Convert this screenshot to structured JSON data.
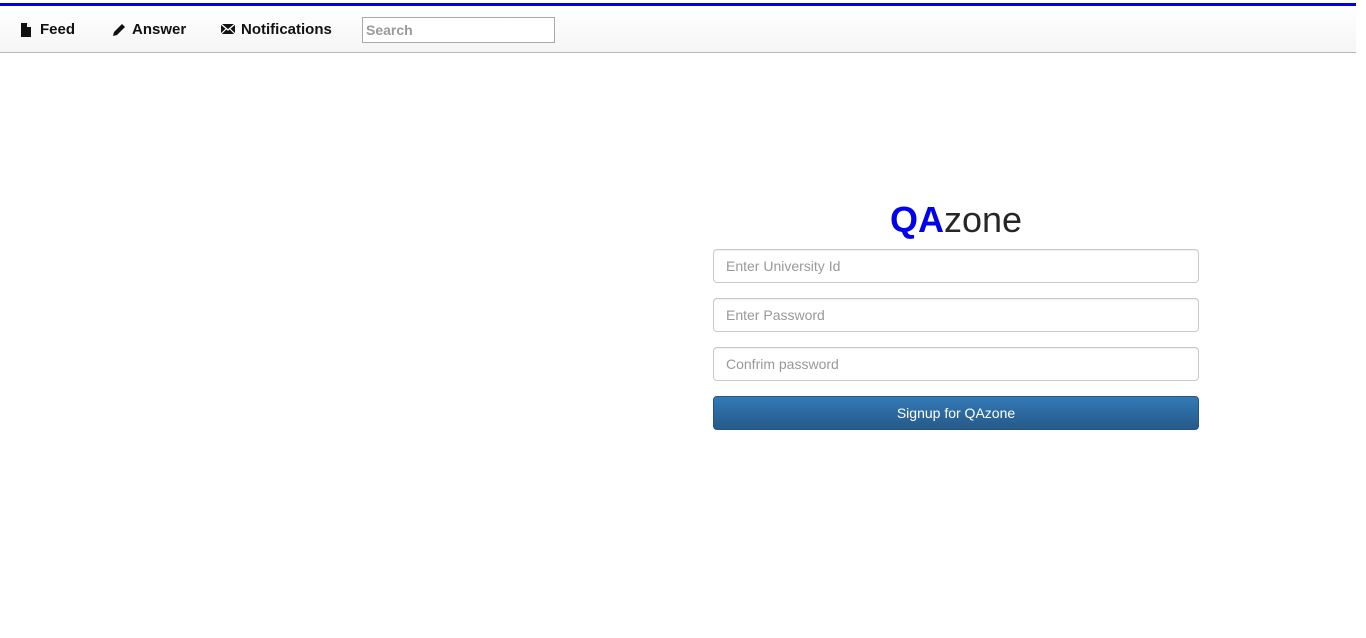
{
  "nav": {
    "feed": {
      "label": "Feed",
      "icon": "file-icon"
    },
    "answer": {
      "label": "Answer",
      "icon": "pencil-icon"
    },
    "notifications": {
      "label": "Notifications",
      "icon": "envelope-icon"
    },
    "search_placeholder": "Search"
  },
  "brand": {
    "qa": "QA",
    "zone": "zone"
  },
  "form": {
    "university_id_placeholder": "Enter University Id",
    "password_placeholder": "Enter Password",
    "confirm_placeholder": "Confrim password",
    "submit_label": "Signup for QAzone"
  },
  "colors": {
    "accent_line": "#0000e0",
    "brand_qa": "#0000ee",
    "button": "#2e6da4"
  }
}
